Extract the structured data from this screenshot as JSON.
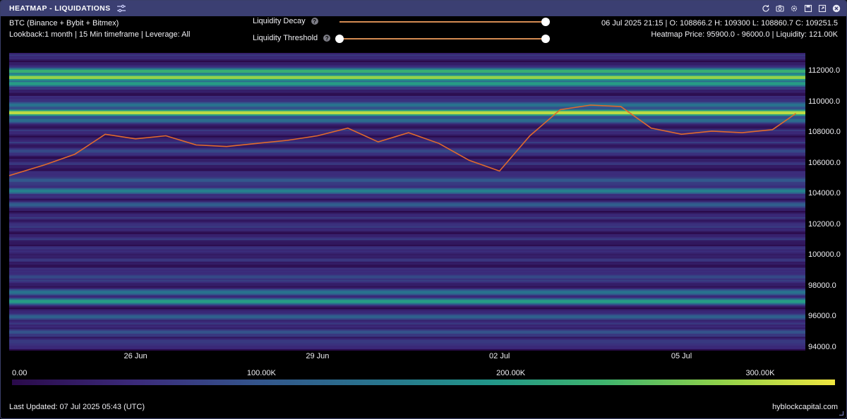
{
  "window": {
    "title": "HEATMAP - LIQUIDATIONS",
    "icons": [
      "filters-icon",
      "refresh-icon",
      "camera-icon",
      "gear-icon",
      "save-icon",
      "expand-icon",
      "close-icon"
    ]
  },
  "info": {
    "line1": "BTC (Binance + Bybit + Bitmex)",
    "line2": "Lookback:1 month | 15 Min timeframe | Leverage: All",
    "ohlc": "06 Jul 2025 21:15 | O: 108866.2 H: 109300 L: 108860.7 C: 109251.5",
    "heatmap_info": "Heatmap Price: 95900.0 - 96000.0 | Liquidity: 121.00K"
  },
  "controls": {
    "decay_label": "Liquidity Decay",
    "threshold_label": "Liquidity Threshold",
    "help_glyph": "?",
    "decay_value": 1.0,
    "threshold_min": 0.0,
    "threshold_max": 1.0
  },
  "colors": {
    "background": "#000000",
    "titlebar": "#3b3f72",
    "price_line": "#e06a2c",
    "slider_track": "#d48b52",
    "heat_low": "#2a0a4a",
    "heat_mid": "#22968a",
    "heat_high": "#f0e640"
  },
  "chart_data": {
    "type": "heatmap",
    "title": "",
    "xlabel": "",
    "ylabel": "",
    "x_ticks": [
      "26 Jun",
      "29 Jun",
      "02 Jul",
      "05 Jul"
    ],
    "y_ticks": [
      "112000.0",
      "110000.0",
      "108000.0",
      "106000.0",
      "104000.0",
      "102000.0",
      "100000.0",
      "98000.0",
      "96000.0",
      "94000.0"
    ],
    "ylim": [
      93800,
      113200
    ],
    "x_range": [
      "2025-06-23 22:00",
      "2025-07-07 01:00"
    ],
    "colorbar_ticks": [
      "0.00",
      "100.00K",
      "200.00K",
      "300.00K"
    ],
    "colorbar_range": [
      0,
      330000
    ],
    "price_series": {
      "name": "",
      "x": [
        "2025-06-23 22:00",
        "2025-06-24 12:00",
        "2025-06-25 00:00",
        "2025-06-25 12:00",
        "2025-06-26 00:00",
        "2025-06-26 12:00",
        "2025-06-27 00:00",
        "2025-06-27 12:00",
        "2025-06-28 00:00",
        "2025-06-28 12:00",
        "2025-06-29 00:00",
        "2025-06-29 12:00",
        "2025-06-30 00:00",
        "2025-06-30 12:00",
        "2025-07-01 00:00",
        "2025-07-01 12:00",
        "2025-07-02 00:00",
        "2025-07-02 12:00",
        "2025-07-03 00:00",
        "2025-07-03 12:00",
        "2025-07-04 00:00",
        "2025-07-04 12:00",
        "2025-07-05 00:00",
        "2025-07-05 12:00",
        "2025-07-06 00:00",
        "2025-07-06 12:00",
        "2025-07-06 21:15"
      ],
      "y": [
        105200,
        105900,
        106600,
        107900,
        107600,
        107800,
        107200,
        107100,
        107300,
        107500,
        107800,
        108300,
        107400,
        108000,
        107300,
        106200,
        105500,
        107800,
        109500,
        109800,
        109700,
        108300,
        107900,
        108100,
        108000,
        108200,
        109251
      ]
    },
    "bands": [
      {
        "price": 112000,
        "liquidity": 240000
      },
      {
        "price": 111600,
        "liquidity": 300000
      },
      {
        "price": 111200,
        "liquidity": 210000
      },
      {
        "price": 109800,
        "liquidity": 150000
      },
      {
        "price": 109300,
        "liquidity": 320000
      },
      {
        "price": 108800,
        "liquidity": 140000
      },
      {
        "price": 106800,
        "liquidity": 90000
      },
      {
        "price": 104900,
        "liquidity": 110000
      },
      {
        "price": 104200,
        "liquidity": 170000
      },
      {
        "price": 103300,
        "liquidity": 120000
      },
      {
        "price": 102000,
        "liquidity": 60000
      },
      {
        "price": 100200,
        "liquidity": 40000
      },
      {
        "price": 98600,
        "liquidity": 90000
      },
      {
        "price": 97600,
        "liquidity": 150000
      },
      {
        "price": 97000,
        "liquidity": 210000
      },
      {
        "price": 96000,
        "liquidity": 121000
      },
      {
        "price": 95000,
        "liquidity": 100000
      },
      {
        "price": 94400,
        "liquidity": 70000
      }
    ]
  },
  "footer": {
    "last_updated": "Last Updated: 07 Jul 2025 05:43 (UTC)",
    "brand": "hyblockcapital.com"
  }
}
